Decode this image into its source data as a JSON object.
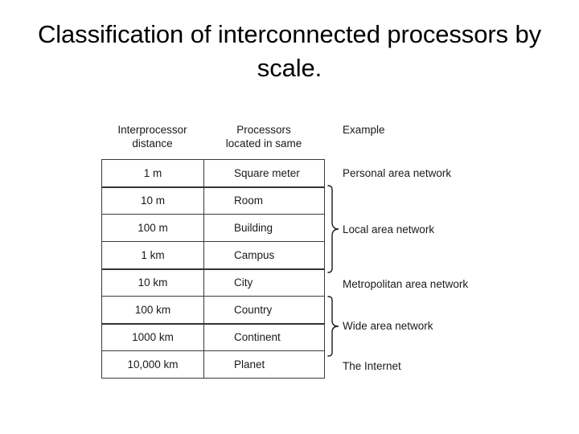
{
  "slide": {
    "title": "Classification of interconnected processors by scale."
  },
  "table": {
    "headers": {
      "distance_line1": "Interprocessor",
      "distance_line2": "distance",
      "located_line1": "Processors",
      "located_line2": "located in same",
      "example": "Example"
    },
    "rows": [
      {
        "distance": "1 m",
        "location": "Square meter"
      },
      {
        "distance": "10 m",
        "location": "Room"
      },
      {
        "distance": "100 m",
        "location": "Building"
      },
      {
        "distance": "1 km",
        "location": "Campus"
      },
      {
        "distance": "10 km",
        "location": "City"
      },
      {
        "distance": "100 km",
        "location": "Country"
      },
      {
        "distance": "1000 km",
        "location": "Continent"
      },
      {
        "distance": "10,000 km",
        "location": "Planet"
      }
    ],
    "examples": [
      {
        "label": "Personal area network",
        "braced": false
      },
      {
        "label": "Local area network",
        "braced": true
      },
      {
        "label": "Metropolitan area network",
        "braced": false
      },
      {
        "label": "Wide area network",
        "braced": true
      },
      {
        "label": "The Internet",
        "braced": false
      }
    ]
  },
  "colors": {
    "text": "#1a1a1a",
    "title": "#000000",
    "rule": "#3a3a3a",
    "rule_thick": "#333333",
    "background": "#ffffff"
  }
}
